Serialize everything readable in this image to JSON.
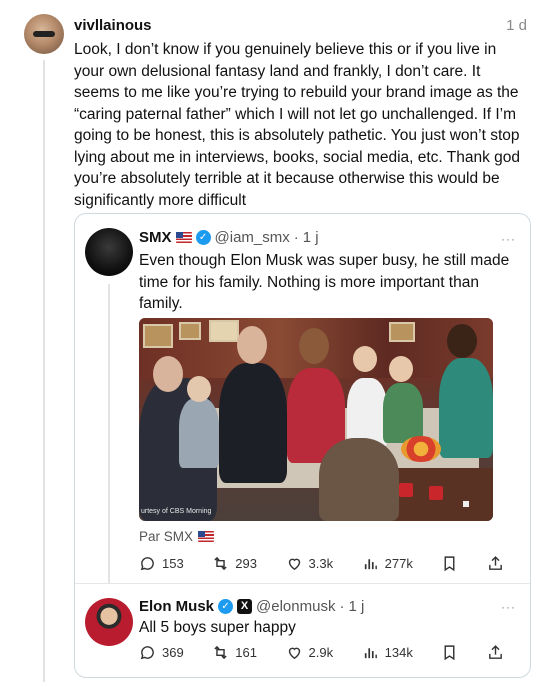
{
  "post": {
    "username": "vivllainous",
    "time": "1 d",
    "text": "Look, I don’t know if you genuinely believe this or if you live in your own delusional fantasy land and frankly, I don’t care. It seems to me like you’re trying to rebuild your brand image as the “caring paternal father” which I will not let go unchallenged.  If I’m going to be honest, this is absolutely pathetic. You just won’t stop lying about me in interviews, books, social media, etc. Thank god you’re absolutely terrible at it because otherwise this would be significantly more difficult"
  },
  "quoted_post": {
    "name": "SMX",
    "handle": "@iam_smx",
    "time": "1 j",
    "text": "Even though Elon Musk was super busy, he still made time for his family. Nothing is more important than family.",
    "video_credit": "urtesy of CBS Morning",
    "via_label": "Par SMX",
    "stats": {
      "replies": "153",
      "reposts": "293",
      "likes": "3.3k",
      "views": "277k"
    },
    "more": "···"
  },
  "reply_post": {
    "name": "Elon Musk",
    "handle": "@elonmusk",
    "time": "1 j",
    "text": "All 5 boys super happy",
    "stats": {
      "replies": "369",
      "reposts": "161",
      "likes": "2.9k",
      "views": "134k"
    },
    "more": "···"
  },
  "colors": {
    "verified": "#1d9bf0",
    "border": "#cfd9de",
    "muted": "#8a8a8a"
  }
}
